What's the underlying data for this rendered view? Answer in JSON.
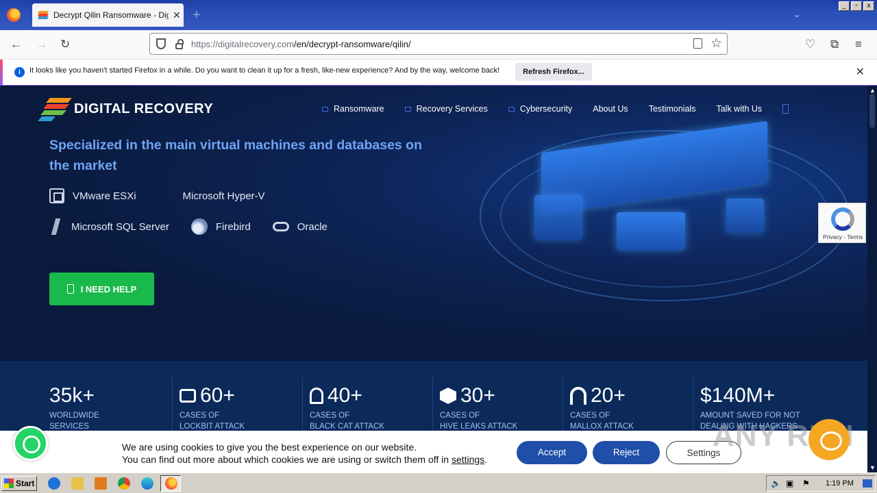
{
  "browser": {
    "tab_title": "Decrypt Qilin Ransomware - Digital",
    "url_host": "https://digitalrecovery.com",
    "url_path": "/en/decrypt-ransomware/qilin/",
    "notification": "It looks like you haven't started Firefox in a while. Do you want to clean it up for a fresh, like-new experience? And by the way, welcome back!",
    "refresh_button": "Refresh Firefox..."
  },
  "site": {
    "logo_text": "DIGITAL RECOVERY",
    "nav": [
      "Ransomware",
      "Recovery Services",
      "Cybersecurity",
      "About Us",
      "Testimonials",
      "Talk with Us"
    ],
    "headline": "Specialized in the main virtual machines and databases on the market",
    "platforms_row1": [
      "VMware ESXi",
      "Microsoft Hyper-V"
    ],
    "platforms_row2": [
      "Microsoft SQL Server",
      "Firebird",
      "Oracle"
    ],
    "help_button": "I NEED HELP",
    "recaptcha": "Privacy - Terms"
  },
  "stats": [
    {
      "num": "35k+",
      "line1": "WORLDWIDE",
      "line2": "SERVICES"
    },
    {
      "num": "60+",
      "line1": "CASES OF",
      "line2": "LOCKBIT ATTACK"
    },
    {
      "num": "40+",
      "line1": "CASES OF",
      "line2": "BLACK CAT ATTACK"
    },
    {
      "num": "30+",
      "line1": "CASES OF",
      "line2": "HIVE LEAKS ATTACK"
    },
    {
      "num": "20+",
      "line1": "CASES OF",
      "line2": "MALLOX ATTACK"
    },
    {
      "num": "$140M+",
      "line1": "AMOUNT SAVED FOR NOT",
      "line2": "DEALING WITH HACKERS"
    }
  ],
  "cookie": {
    "line1": "We are using cookies to give you the best experience on our website.",
    "line2_prefix": "You can find out more about which cookies we are using or switch them off in ",
    "line2_link": "settings",
    "line2_suffix": ".",
    "accept": "Accept",
    "reject": "Reject",
    "settings": "Settings"
  },
  "watermark": "ANY RUN",
  "taskbar": {
    "start": "Start",
    "clock": "1:19 PM"
  },
  "colors": {
    "accent_green": "#1ab94b",
    "headline_blue": "#6fa4f5",
    "cookie_button": "#1f4fa8"
  }
}
